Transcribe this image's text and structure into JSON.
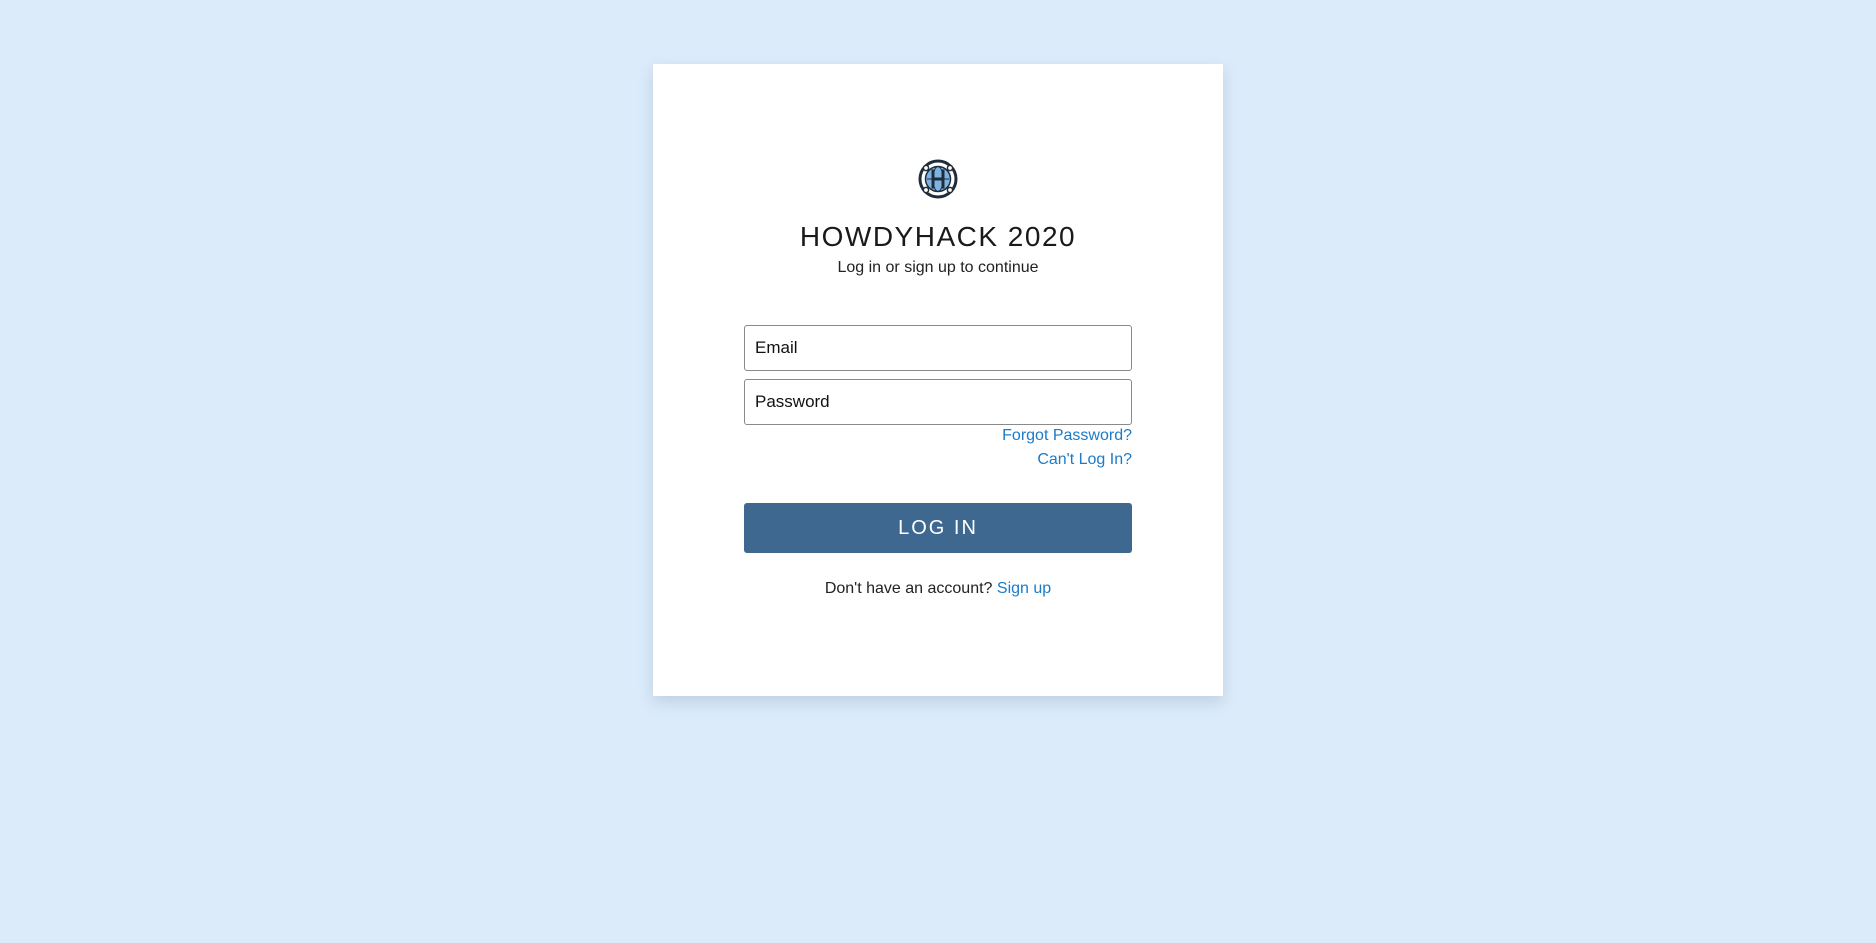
{
  "app": {
    "title": "HOWDYHACK 2020",
    "subtitle": "Log in or sign up to continue",
    "logo_icon": "howdyhack-globe-logo"
  },
  "form": {
    "email_placeholder": "Email",
    "password_placeholder": "Password",
    "forgot_password_link": "Forgot Password?",
    "cant_login_link": "Can't Log In?",
    "login_button": "LOG IN",
    "signup_prompt": "Don't have an account?",
    "signup_link": "Sign up"
  },
  "colors": {
    "page_background": "#dbebfa",
    "card_background": "#ffffff",
    "primary_button": "#3e6890",
    "link": "#1a7bc9"
  }
}
